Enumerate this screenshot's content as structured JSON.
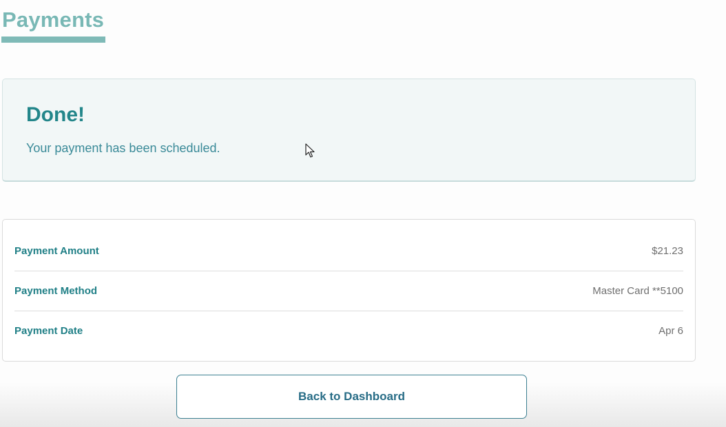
{
  "header": {
    "title": "Payments"
  },
  "confirmation": {
    "heading": "Done!",
    "message": "Your payment has been scheduled."
  },
  "details": {
    "rows": [
      {
        "label": "Payment Amount",
        "value": "$21.23"
      },
      {
        "label": "Payment Method",
        "value": "Master Card **5100"
      },
      {
        "label": "Payment Date",
        "value": "Apr 6"
      }
    ]
  },
  "actions": {
    "back_label": "Back to Dashboard"
  },
  "colors": {
    "accent": "#79b8b5",
    "primary_text": "#23868a",
    "button_border": "#3a7e90",
    "card_bg": "#f2f7f7"
  },
  "icons": {
    "cursor": "mouse-pointer-icon"
  }
}
